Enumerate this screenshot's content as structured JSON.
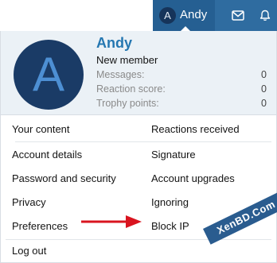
{
  "header": {
    "account": {
      "avatar_letter": "A",
      "username": "Andy"
    },
    "inbox_icon": "envelope-icon",
    "alerts_icon": "bell-icon"
  },
  "profile": {
    "avatar_letter": "A",
    "name": "Andy",
    "title": "New member",
    "stats": [
      {
        "label": "Messages:",
        "value": "0"
      },
      {
        "label": "Reaction score:",
        "value": "0"
      },
      {
        "label": "Trophy points:",
        "value": "0"
      }
    ]
  },
  "menu": {
    "left": [
      "Your content",
      "Account details",
      "Password and security",
      "Privacy",
      "Preferences"
    ],
    "right": [
      "Reactions received",
      "Signature",
      "Account upgrades",
      "Ignoring",
      "Block IP"
    ],
    "logout": "Log out"
  },
  "annotation": {
    "arrow_color": "#d9141f"
  },
  "watermark": "XenBD.Com",
  "colors": {
    "nav": "#2f6ca0",
    "profile_bg": "#ebf1f6",
    "name": "#2577b1",
    "avatar": "#1a3b66"
  }
}
